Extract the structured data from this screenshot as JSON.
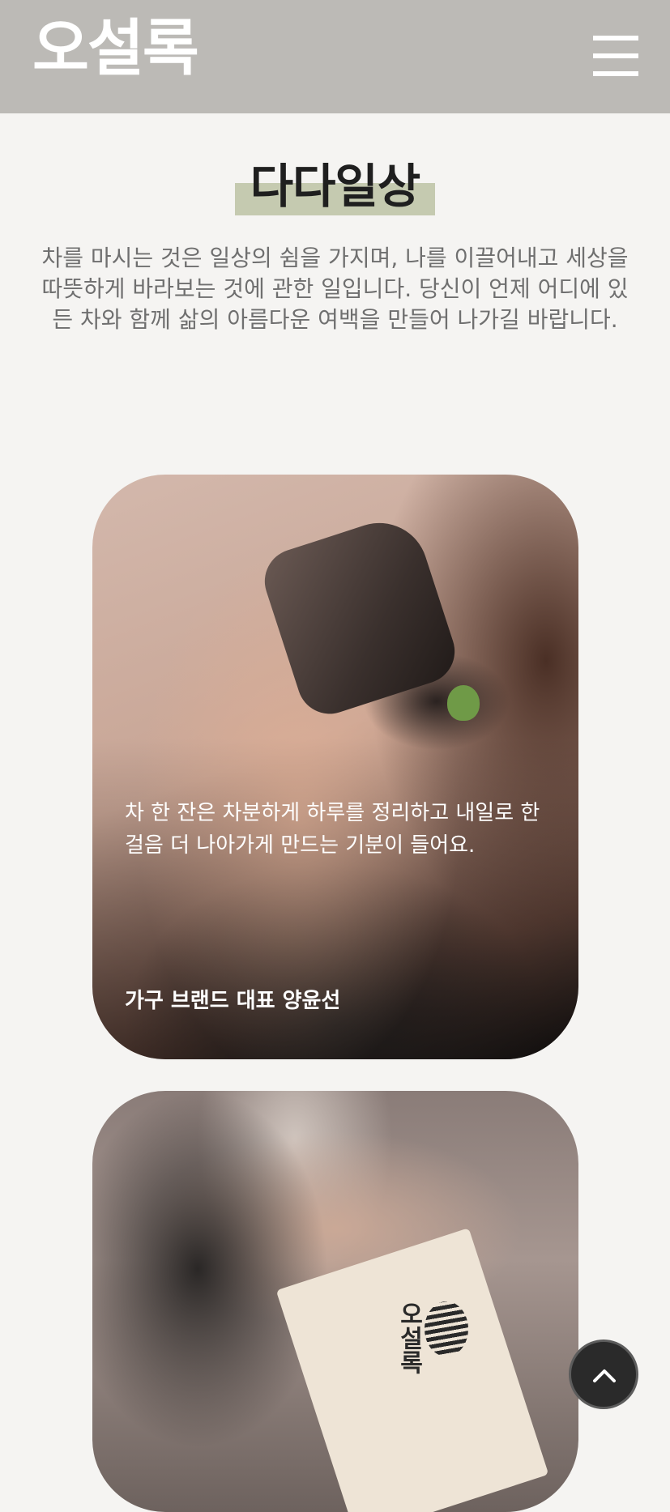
{
  "header": {
    "logo": "오설록",
    "menu_icon": "hamburger-icon"
  },
  "section": {
    "title": "다다일상",
    "intro": "차를 마시는 것은 일상의 쉼을 가지며, 나를 이끌어내고 세상을 따뜻하게 바라보는 것에 관한 일입니다. 당신이 언제 어디에 있든 차와 함께 삶의 아름다운 여백을 만들어 나가길 바랍니다."
  },
  "cards": [
    {
      "quote": "차 한 잔은 차분하게 하루를 정리하고 내일로 한 걸음 더 나아가게 만드는 기분이 들어요.",
      "author": "가구 브랜드 대표 양윤선"
    },
    {
      "quote": "",
      "author": "",
      "packet_text": "오설록"
    }
  ],
  "scroll_top": {
    "icon": "chevron-up-icon"
  },
  "colors": {
    "header_bg": "#bcbab6",
    "title_highlight": "#c5cab0",
    "page_bg": "#f5f4f2"
  }
}
